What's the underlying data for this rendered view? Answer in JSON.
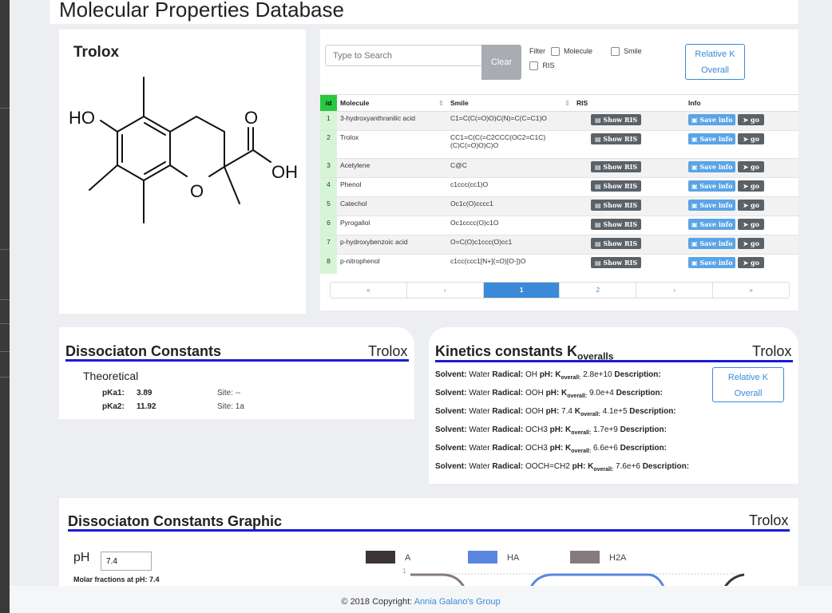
{
  "page_title": "Molecular Properties Database",
  "molecule": {
    "name": "Trolox",
    "structure_labels": {
      "ho": "HO",
      "o_ring": "O",
      "o_carbonyl": "O",
      "oh": "OH"
    }
  },
  "search": {
    "placeholder": "Type to Search",
    "clear_label": "Clear",
    "filter_label": "Filter",
    "filter_options": [
      "Molecule",
      "Smile",
      "RIS"
    ],
    "relative_k_label": "Relative K Overall"
  },
  "table": {
    "headers": [
      "id",
      "Molecule",
      "Smile",
      "RIS",
      "Info"
    ],
    "show_ris_label": "Show RIS",
    "save_info_label": "Save info",
    "go_label": "go",
    "rows": [
      {
        "id": "1",
        "molecule": "3-hydroxyanthranilic acid",
        "smile": "C1=C(C(=O)O)C(N)=C(C=C1)O"
      },
      {
        "id": "2",
        "molecule": "Trolox",
        "smile": "CC1=C(C(=C2CCC(OC2=C1C)(C)C(=O)O)C)O"
      },
      {
        "id": "3",
        "molecule": "Acetylene",
        "smile": "C@C"
      },
      {
        "id": "4",
        "molecule": "Phenol",
        "smile": "c1ccc(cc1)O"
      },
      {
        "id": "5",
        "molecule": "Catechol",
        "smile": "Oc1c(O)cccc1"
      },
      {
        "id": "6",
        "molecule": "Pyrogallol",
        "smile": "Oc1cccc(O)c1O"
      },
      {
        "id": "7",
        "molecule": "p-hydroxybenzoic acid",
        "smile": "O=C(O)c1ccc(O)cc1"
      },
      {
        "id": "8",
        "molecule": "p-nitrophenol",
        "smile": "c1cc(ccc1[N+](=O)[O-])O"
      }
    ]
  },
  "pagination": {
    "first": "«",
    "prev": "‹",
    "page1": "1",
    "page2": "2",
    "next": "›",
    "last": "»",
    "current": 1
  },
  "dissociation": {
    "title": "Dissociaton Constants",
    "molecule": "Trolox",
    "subtitle": "Theoretical",
    "rows": [
      {
        "label": "pKa1:",
        "value": "3.89",
        "site": "Site: --"
      },
      {
        "label": "pKa2:",
        "value": "11.92",
        "site": "Site: 1a"
      }
    ]
  },
  "kinetics": {
    "title": "Kinetics constants K",
    "title_sub": "overalls",
    "molecule": "Trolox",
    "relative_k_label": "Relative K Overall",
    "solvent_label": "Solvent:",
    "radical_label": "Radical:",
    "ph_label": "pH:",
    "k_label": "K",
    "k_sub": "overall:",
    "description_label": "Description:",
    "rows": [
      {
        "solvent": "Water",
        "radical": "OH",
        "ph": "",
        "k": "2.8e+10"
      },
      {
        "solvent": "Water",
        "radical": "OOH",
        "ph": "",
        "k": "9.0e+4"
      },
      {
        "solvent": "Water",
        "radical": "OOH",
        "ph": "7.4",
        "k": "4.1e+5"
      },
      {
        "solvent": "Water",
        "radical": "OCH3",
        "ph": "",
        "k": "1.7e+9"
      },
      {
        "solvent": "Water",
        "radical": "OCH3",
        "ph": "",
        "k": "6.6e+6"
      },
      {
        "solvent": "Water",
        "radical": "OOCH=CH2",
        "ph": "",
        "k": "7.6e+6"
      }
    ]
  },
  "graphic": {
    "title": "Dissociaton Constants Graphic",
    "molecule": "Trolox",
    "ph_label": "pH",
    "ph_value": "7.4",
    "molar_fraction_text": "Molar fractions at pH: 7.4"
  },
  "chart_data": {
    "type": "line",
    "series": [
      {
        "name": "A",
        "color": "#3c3438"
      },
      {
        "name": "HA",
        "color": "#5a86e0"
      },
      {
        "name": "H2A",
        "color": "#857a7e"
      }
    ],
    "y_tick_top": "1"
  },
  "footer": {
    "text": "© 2018 Copyright: ",
    "link": "Annia Galano's Group"
  },
  "colors": {
    "accent": "#3a8ad8",
    "heading_line": "#1a1ad8",
    "id_header": "#28c840"
  }
}
